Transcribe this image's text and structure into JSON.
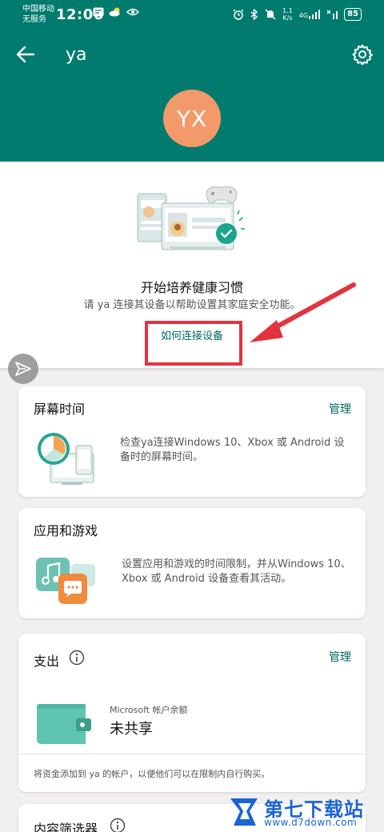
{
  "status_bar": {
    "carrier1": "中国移动",
    "carrier2": "无服务",
    "time": "12:06",
    "net_speed_value": "1.1",
    "net_speed_unit": "K/s",
    "net_type": "4G",
    "battery": "85"
  },
  "app_bar": {
    "title": "ya",
    "back_icon": "arrow-left-icon",
    "settings_icon": "gear-icon"
  },
  "profile": {
    "initials": "YX",
    "avatar_color": "#f29a6a"
  },
  "promo": {
    "title": "开始培养健康习惯",
    "subtitle": "请 ya 连接其设备以帮助设置其家庭安全功能。",
    "link": "如何连接设备"
  },
  "screen_time": {
    "title": "屏幕时间",
    "manage": "管理",
    "description": "检查ya连接Windows 10、Xbox 或 Android 设备时的屏幕时间。"
  },
  "apps_games": {
    "title": "应用和游戏",
    "description": "设置应用和游戏的时间限制，并从Windows 10、Xbox 或 Android 设备查看其活动。"
  },
  "spending": {
    "title": "支出",
    "manage": "管理",
    "balance_label": "Microsoft 帐户余额",
    "balance_value": "未共享",
    "footer": "将资金添加到 ya 的帐户，以便他们可以在限制内自行购买。"
  },
  "content_filter": {
    "title": "内容筛选器"
  },
  "watermark": {
    "text": "第七下载站",
    "url": "www.d7down.com"
  },
  "colors": {
    "brand_teal": "#007b6d",
    "link_teal": "#00685c",
    "annotation_red": "#e2343f"
  }
}
